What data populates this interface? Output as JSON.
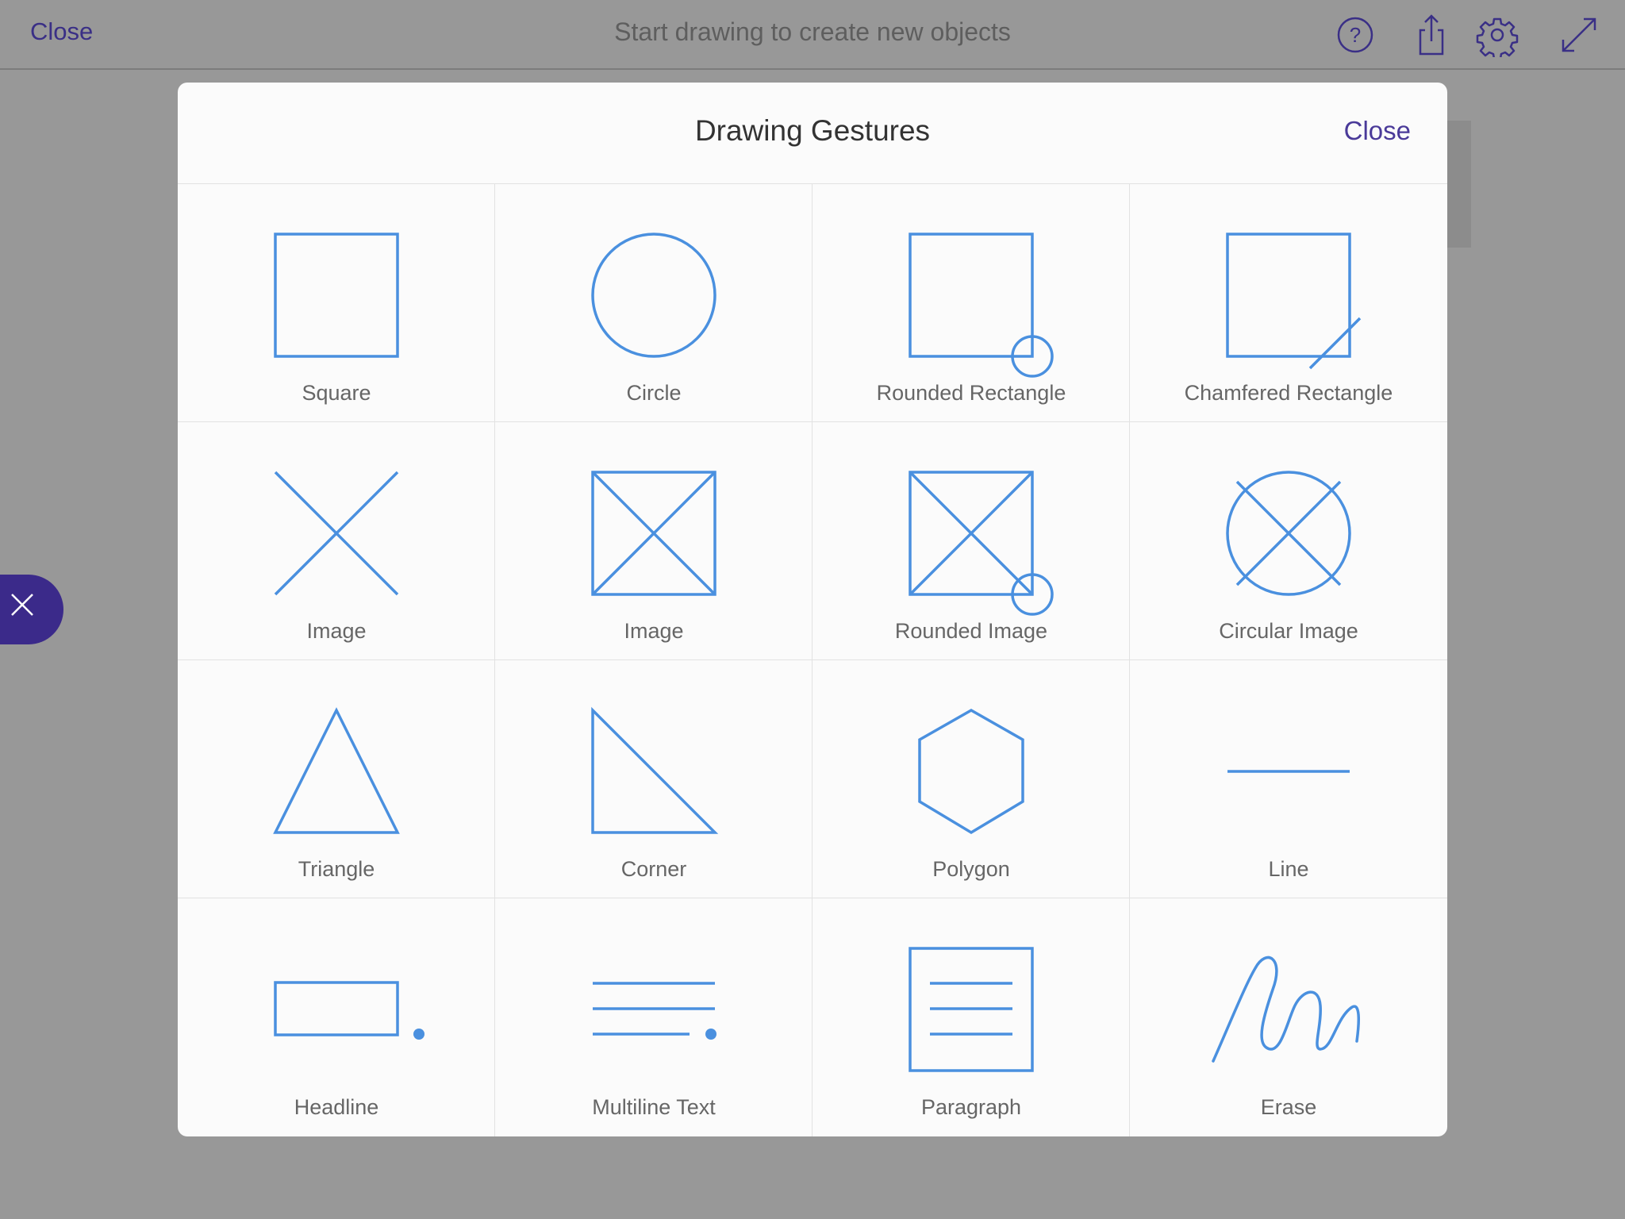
{
  "topbar": {
    "close_label": "Close",
    "title": "Start drawing to create new objects",
    "icons": [
      "help-icon",
      "share-icon",
      "gear-icon",
      "expand-icon"
    ]
  },
  "modal": {
    "title": "Drawing Gestures",
    "close_label": "Close",
    "gestures": [
      {
        "label": "Square",
        "icon": "square-icon"
      },
      {
        "label": "Circle",
        "icon": "circle-icon"
      },
      {
        "label": "Rounded Rectangle",
        "icon": "rounded-rectangle-icon"
      },
      {
        "label": "Chamfered Rectangle",
        "icon": "chamfered-rectangle-icon"
      },
      {
        "label": "Image",
        "icon": "x-image-icon"
      },
      {
        "label": "Image",
        "icon": "boxed-image-icon"
      },
      {
        "label": "Rounded Image",
        "icon": "rounded-image-icon"
      },
      {
        "label": "Circular Image",
        "icon": "circular-image-icon"
      },
      {
        "label": "Triangle",
        "icon": "triangle-icon"
      },
      {
        "label": "Corner",
        "icon": "corner-icon"
      },
      {
        "label": "Polygon",
        "icon": "polygon-icon"
      },
      {
        "label": "Line",
        "icon": "line-icon"
      },
      {
        "label": "Headline",
        "icon": "headline-icon"
      },
      {
        "label": "Multiline Text",
        "icon": "multiline-text-icon"
      },
      {
        "label": "Paragraph",
        "icon": "paragraph-icon"
      },
      {
        "label": "Erase",
        "icon": "erase-icon"
      }
    ]
  },
  "colors": {
    "accent": "#3b2a8a",
    "gesture_stroke": "#4a90df",
    "overlay": "#989898",
    "modal_bg": "#fbfbfb"
  }
}
